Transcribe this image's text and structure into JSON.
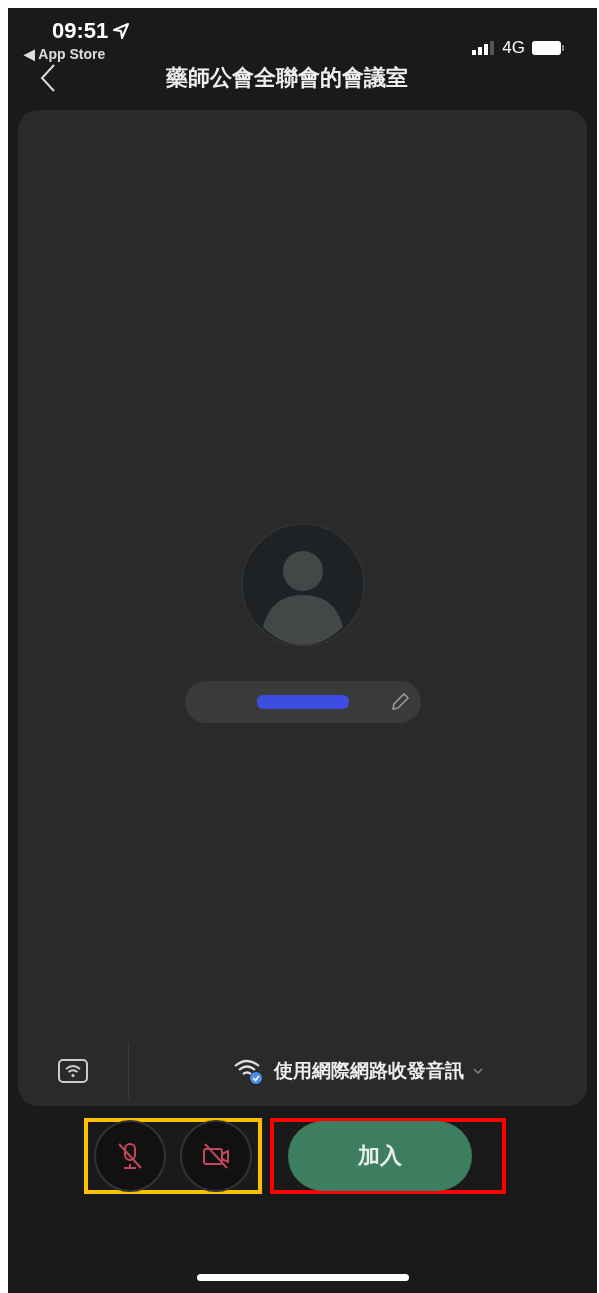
{
  "status_bar": {
    "time": "09:51",
    "back_app": "◀ App Store",
    "network": "4G"
  },
  "header": {
    "title": "藥師公會全聯會的會議室"
  },
  "preview": {
    "name_redacted": true
  },
  "audio_bar": {
    "label": "使用網際網路收發音訊"
  },
  "controls": [
    {
      "kind": "mic",
      "on": false
    },
    {
      "kind": "camera",
      "on": false
    }
  ],
  "join_button": {
    "label": "加入"
  },
  "highlights": [
    {
      "color": "#ffc000"
    },
    {
      "color": "#ff0000"
    }
  ]
}
